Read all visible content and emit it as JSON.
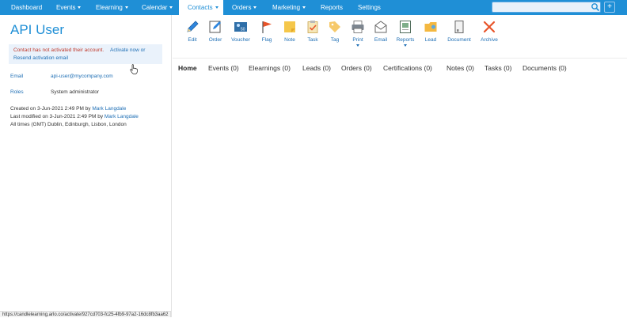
{
  "nav": {
    "items": [
      {
        "label": "Dashboard",
        "dropdown": false
      },
      {
        "label": "Events",
        "dropdown": true
      },
      {
        "label": "Elearning",
        "dropdown": true
      },
      {
        "label": "Calendar",
        "dropdown": true
      },
      {
        "label": "Contacts",
        "dropdown": true,
        "active": true
      },
      {
        "label": "Orders",
        "dropdown": true
      },
      {
        "label": "Marketing",
        "dropdown": true
      },
      {
        "label": "Reports",
        "dropdown": false
      },
      {
        "label": "Settings",
        "dropdown": false
      }
    ],
    "search_value": "",
    "plus_label": "+"
  },
  "contact": {
    "name": "API User",
    "alert": {
      "message": "Contact has not activated their account.",
      "activate_link": "Activate now",
      "or": "or",
      "resend_link": "Resend activation email"
    },
    "email_label": "Email",
    "email_value": "api-user@mycompany.com",
    "roles_label": "Roles",
    "roles_value": "System administrator",
    "created_prefix": "Created on 3-Jun-2021 2:49 PM by",
    "created_by": "Mark Langdale",
    "modified_prefix": "Last modified on 3-Jun-2021 2:49 PM by",
    "modified_by": "Mark Langdale",
    "timezone": "All times (GMT) Dublin, Edinburgh, Lisbon, London"
  },
  "toolbar": [
    {
      "label": "Edit",
      "icon": "pencil-icon"
    },
    {
      "label": "Order",
      "icon": "order-icon"
    },
    {
      "label": "Voucher",
      "icon": "voucher-icon"
    },
    {
      "label": "Flag",
      "icon": "flag-icon"
    },
    {
      "label": "Note",
      "icon": "note-icon"
    },
    {
      "label": "Task",
      "icon": "task-icon"
    },
    {
      "label": "Tag",
      "icon": "tag-icon"
    },
    {
      "label": "Print",
      "icon": "printer-icon",
      "dropdown": true
    },
    {
      "label": "Email",
      "icon": "envelope-icon"
    },
    {
      "label": "Reports",
      "icon": "report-icon",
      "dropdown": true
    },
    {
      "label": "Lead",
      "icon": "folder-icon"
    },
    {
      "label": "Document",
      "icon": "document-icon"
    },
    {
      "label": "Archive",
      "icon": "close-x-icon"
    }
  ],
  "tabs": [
    {
      "label": "Home",
      "active": true
    },
    {
      "label": "Events (0)"
    },
    {
      "label": "Elearnings (0)"
    },
    {
      "label": "Leads (0)"
    },
    {
      "label": "Orders (0)"
    },
    {
      "label": "Certifications (0)"
    },
    {
      "label": "Notes (0)"
    },
    {
      "label": "Tasks (0)"
    },
    {
      "label": "Documents (0)"
    }
  ],
  "status_url": "https://candlelearning.arlo.co/activate/927cd703-fc25-4fb9-97a2-16dc8fb3aa62",
  "colors": {
    "primary": "#1f8fd6",
    "link": "#1f6fb5",
    "alert_text": "#c0392b",
    "alert_bg": "#eaf2fb"
  }
}
